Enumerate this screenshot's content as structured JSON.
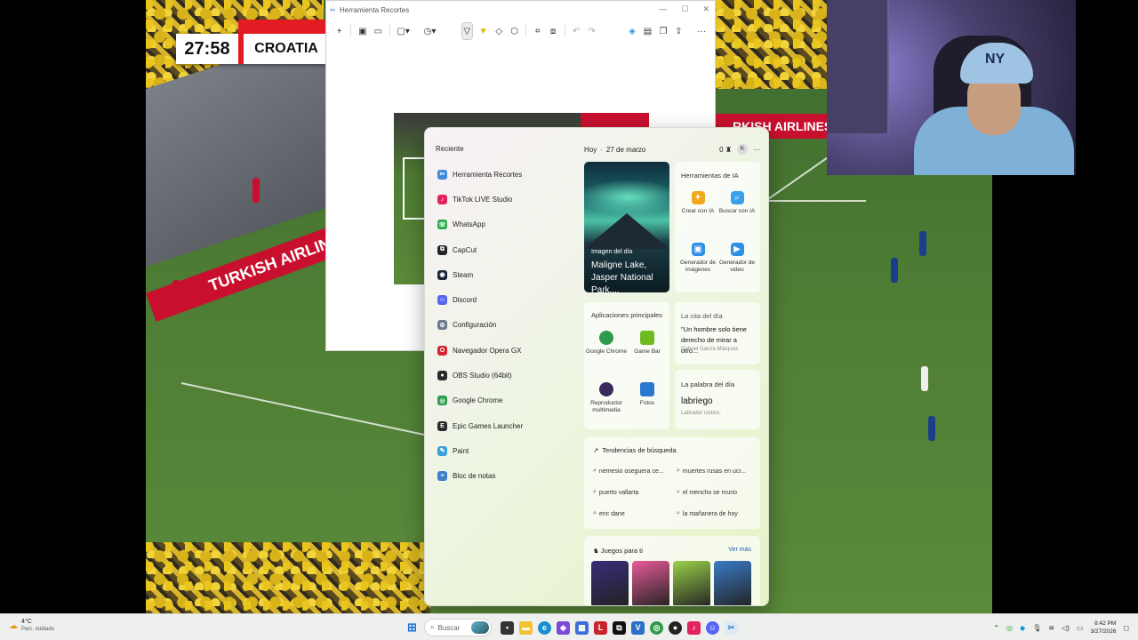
{
  "broadcast": {
    "clock": "27:58",
    "team": "CROATIA",
    "ad_text": "TURKISH AIRLINES",
    "ad_text_right": "RKISH AIRLINES"
  },
  "webcam": {
    "cap_logo": "NY"
  },
  "snip_window": {
    "title": "Herramienta Recortes",
    "minimize": "—",
    "maximize": "☐",
    "close": "✕"
  },
  "start_menu": {
    "recent_title": "Reciente",
    "recent_items": [
      {
        "label": "Herramienta Recortes",
        "color": "#3c8ad8",
        "glyph": "✂"
      },
      {
        "label": "TikTok LIVE Studio",
        "color": "#e3245c",
        "glyph": "♪"
      },
      {
        "label": "WhatsApp",
        "color": "#25a84a",
        "glyph": "☏"
      },
      {
        "label": "CapCut",
        "color": "#222222",
        "glyph": "⧉"
      },
      {
        "label": "Steam",
        "color": "#1b2838",
        "glyph": "◉"
      },
      {
        "label": "Discord",
        "color": "#5865f2",
        "glyph": "☺"
      },
      {
        "label": "Configuración",
        "color": "#6b7a8c",
        "glyph": "⚙"
      },
      {
        "label": "Navegador Opera GX",
        "color": "#d6242f",
        "glyph": "O"
      },
      {
        "label": "OBS Studio (64bit)",
        "color": "#2a2a2a",
        "glyph": "●"
      },
      {
        "label": "Google Chrome",
        "color": "#2e9a4b",
        "glyph": "◎"
      },
      {
        "label": "Epic Games Launcher",
        "color": "#2b2b2b",
        "glyph": "E"
      },
      {
        "label": "Paint",
        "color": "#3aa0d8",
        "glyph": "✎"
      },
      {
        "label": "Bloc de notas",
        "color": "#3e7fc9",
        "glyph": "≡"
      }
    ],
    "header": {
      "today": "Hoy",
      "dot": "·",
      "date": "27 de marzo",
      "points": "0",
      "avatar": "K",
      "more": "···"
    },
    "image_of_day": {
      "label": "Imagen del día",
      "title": "Maligne Lake, Jasper National Park,..."
    },
    "ai_tools": {
      "title": "Herramientas de IA",
      "items": [
        {
          "label": "Crear con IA",
          "color": "#f0a81c",
          "glyph": "✦"
        },
        {
          "label": "Buscar con IA",
          "color": "#3aa0e8",
          "glyph": "⌕"
        },
        {
          "label": "Generador de imágenes",
          "color": "#2d8fe6",
          "glyph": "▣"
        },
        {
          "label": "Generador de video",
          "color": "#2d8fe6",
          "glyph": "▶"
        }
      ]
    },
    "top_apps": {
      "title": "Aplicaciones principales",
      "items": [
        {
          "label": "Google Chrome",
          "color": "#2e9a4b"
        },
        {
          "label": "Game Bar",
          "color": "#6dbb1f"
        },
        {
          "label": "Reproductor multimedia",
          "color": "#3a2a5e"
        },
        {
          "label": "Fotos",
          "color": "#2a78d1"
        }
      ]
    },
    "quote": {
      "title": "La cita del día",
      "text": "\"Un hombre solo tiene derecho de mirar a otro...",
      "author": "Gabriel García Márquez"
    },
    "word": {
      "title": "La palabra del día",
      "word": "labriego",
      "definition": "Labrador rústico."
    },
    "trends": {
      "title": "Tendencias de búsqueda",
      "items": [
        "nemesio oseguera ce...",
        "muertes rusas en ucr...",
        "puerto vallarta",
        "el mencho se murio",
        "eric dane",
        "la mañanera de hoy"
      ]
    },
    "games": {
      "title": "Juegos para ti",
      "more": "Ver más",
      "colors": [
        "#3a2c7a",
        "#e85a98",
        "#9ad24a",
        "#3a7ac8"
      ]
    }
  },
  "taskbar": {
    "weather_temp": "4°C",
    "weather_cond": "Parc. nublado",
    "search_placeholder": "Buscar",
    "time": "8:42 PM",
    "date": "3/27/2026"
  }
}
